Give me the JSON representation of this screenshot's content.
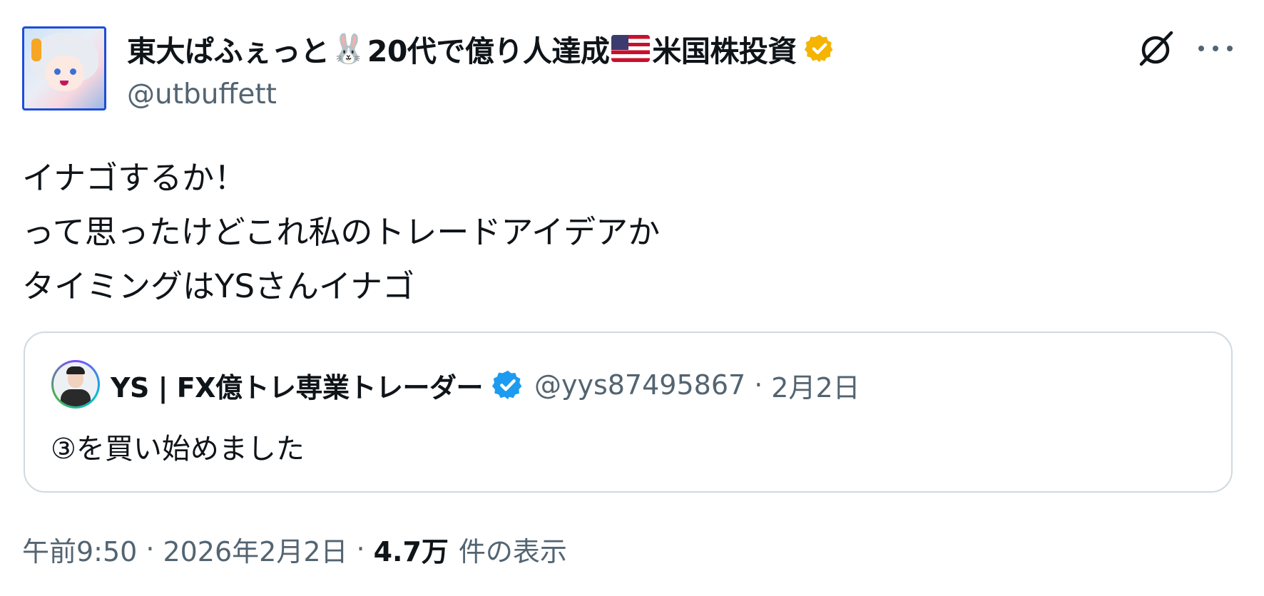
{
  "author": {
    "display_name_part1": "東大ぱふぇっと",
    "rabbit_emoji": "🐰",
    "display_name_part2": "20代で億り人達成",
    "display_name_part3": "米国株投資",
    "handle": "@utbuffett",
    "badge_color": "#f4b400"
  },
  "tweet": {
    "lines": [
      "イナゴするか！",
      "って思ったけどこれ私のトレードアイデアか",
      "タイミングはYSさんイナゴ"
    ]
  },
  "quote": {
    "display_name": "YS | FX億トレ専業トレーダー",
    "handle": "@yys87495867",
    "separator": "·",
    "date": "2月2日",
    "text": "③を買い始めました",
    "badge_color": "#1d9bf0"
  },
  "meta": {
    "time": "午前9:50",
    "separator": "·",
    "date": "2026年2月2日",
    "separator2": "·",
    "views_count": "4.7万",
    "views_label": "件の表示"
  },
  "icons": [
    "grok-icon",
    "more-icon",
    "verified-gold-icon",
    "verified-blue-icon",
    "us-flag-icon"
  ]
}
